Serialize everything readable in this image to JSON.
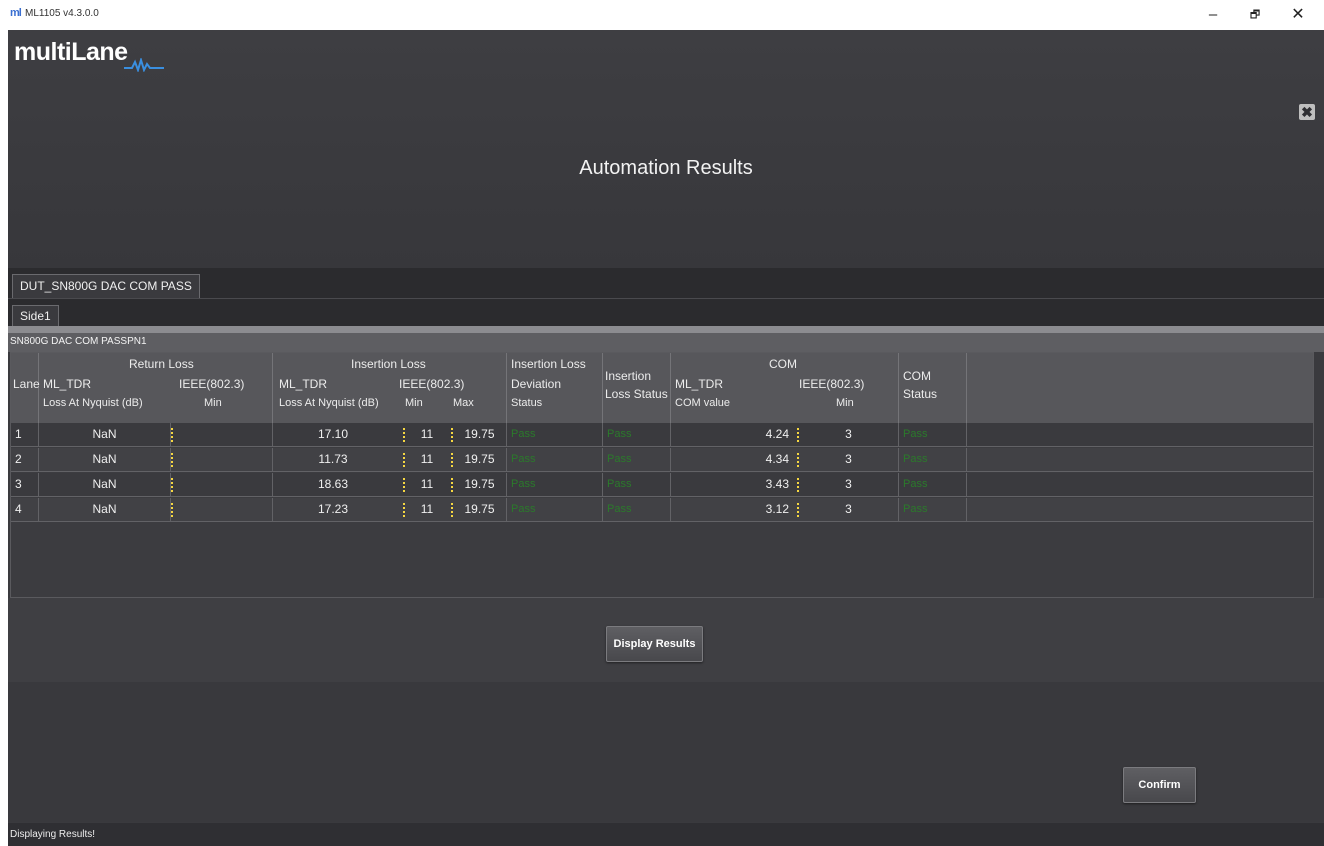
{
  "window": {
    "icon_text": "ml",
    "title": "ML1105 v4.3.0.0",
    "minimize": "–",
    "maximize": "🗗",
    "close": "✕"
  },
  "app": {
    "logo": "multiLane",
    "close_icon": "✖",
    "page_title": "Automation Results"
  },
  "tabs": {
    "outer": "DUT_SN800G DAC COM PASS",
    "inner": "Side1"
  },
  "group_label": "SN800G DAC COM PASSPN1",
  "table": {
    "headers": {
      "lane": "Lane",
      "return_loss": "Return Loss",
      "rl_ml_tdr": "ML_TDR",
      "rl_ieee": "IEEE(802.3)",
      "rl_loss": "Loss At Nyquist (dB)",
      "rl_min": "Min",
      "insertion_loss": "Insertion Loss",
      "il_ml_tdr": "ML_TDR",
      "il_ieee": "IEEE(802.3)",
      "il_loss": "Loss At Nyquist (dB)",
      "il_min": "Min",
      "il_max": "Max",
      "ild_1": "Insertion Loss",
      "ild_2": "Deviation",
      "ild_3": "Status",
      "ils_1": "Insertion",
      "ils_2": "Loss Status",
      "com": "COM",
      "com_ml_tdr": "ML_TDR",
      "com_ieee": "IEEE(802.3)",
      "com_value": "COM value",
      "com_min": "Min",
      "com_status_1": "COM",
      "com_status_2": "Status"
    },
    "rows": [
      {
        "lane": "1",
        "rl_loss": "NaN",
        "rl_min": "",
        "il_loss": "17.10",
        "il_min": "11",
        "il_max": "19.75",
        "ild_status": "Pass",
        "il_status": "Pass",
        "com_value": "4.24",
        "com_min": "3",
        "com_status": "Pass"
      },
      {
        "lane": "2",
        "rl_loss": "NaN",
        "rl_min": "",
        "il_loss": "11.73",
        "il_min": "11",
        "il_max": "19.75",
        "ild_status": "Pass",
        "il_status": "Pass",
        "com_value": "4.34",
        "com_min": "3",
        "com_status": "Pass"
      },
      {
        "lane": "3",
        "rl_loss": "NaN",
        "rl_min": "",
        "il_loss": "18.63",
        "il_min": "11",
        "il_max": "19.75",
        "ild_status": "Pass",
        "il_status": "Pass",
        "com_value": "3.43",
        "com_min": "3",
        "com_status": "Pass"
      },
      {
        "lane": "4",
        "rl_loss": "NaN",
        "rl_min": "",
        "il_loss": "17.23",
        "il_min": "11",
        "il_max": "19.75",
        "ild_status": "Pass",
        "il_status": "Pass",
        "com_value": "3.12",
        "com_min": "3",
        "com_status": "Pass"
      }
    ]
  },
  "buttons": {
    "display_results": "Display Results",
    "confirm": "Confirm"
  },
  "status": "Displaying Results!",
  "colors": {
    "background": "#3a3a3e",
    "pass": "#2b7a2b",
    "separator": "#f5d742"
  }
}
